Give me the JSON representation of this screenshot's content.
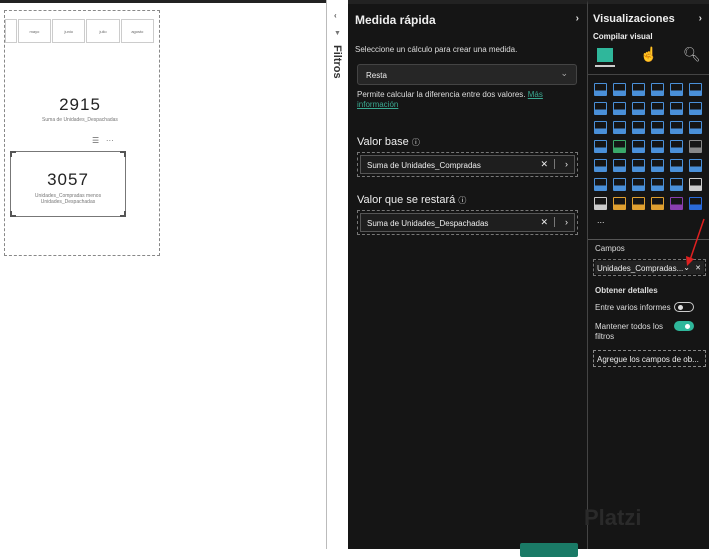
{
  "canvas": {
    "slicer_months": [
      "",
      "mayo",
      "junio",
      "julio",
      "agosto"
    ],
    "card1": {
      "value": "2915",
      "label": "Suma de Unidades_Despachadas"
    },
    "card2": {
      "value": "3057",
      "label": "Unidades_Compradas menos Unidades_Despachadas"
    }
  },
  "filters": {
    "label": "Filtros"
  },
  "quick_measure": {
    "title": "Medida rápida",
    "prompt": "Seleccione un cálculo para crear una medida.",
    "calculation": "Resta",
    "help": "Permite calcular la diferencia entre dos valores.",
    "help_link": "Más información",
    "base_label": "Valor base",
    "base_value": "Suma de Unidades_Compradas",
    "subtract_label": "Valor que se restará",
    "subtract_value": "Suma de Unidades_Despachadas"
  },
  "visualizations": {
    "title": "Visualizaciones",
    "subtitle": "Compilar visual",
    "more": "...",
    "icons": [
      {
        "name": "stacked-bar-icon",
        "color": "#4a90d9"
      },
      {
        "name": "stacked-column-icon",
        "color": "#4a90d9"
      },
      {
        "name": "clustered-bar-icon",
        "color": "#4a90d9"
      },
      {
        "name": "clustered-column-icon",
        "color": "#4a90d9"
      },
      {
        "name": "100-bar-icon",
        "color": "#4a90d9"
      },
      {
        "name": "100-column-icon",
        "color": "#4a90d9"
      },
      {
        "name": "line-chart-icon",
        "color": "#4a90d9"
      },
      {
        "name": "area-chart-icon",
        "color": "#4a90d9"
      },
      {
        "name": "stacked-area-icon",
        "color": "#4a90d9"
      },
      {
        "name": "ribbon-area-icon",
        "color": "#4a90d9"
      },
      {
        "name": "line-column-icon",
        "color": "#4a90d9"
      },
      {
        "name": "line-clustered-icon",
        "color": "#4a90d9"
      },
      {
        "name": "ribbon-chart-icon",
        "color": "#4a90d9"
      },
      {
        "name": "waterfall-icon",
        "color": "#4a90d9"
      },
      {
        "name": "funnel-icon",
        "color": "#4a90d9"
      },
      {
        "name": "scatter-icon",
        "color": "#4a90d9"
      },
      {
        "name": "pie-icon",
        "color": "#4a90d9"
      },
      {
        "name": "donut-icon",
        "color": "#4a90d9"
      },
      {
        "name": "treemap-icon",
        "color": "#4a90d9"
      },
      {
        "name": "map-icon",
        "color": "#3aa96a"
      },
      {
        "name": "filled-map-icon",
        "color": "#4a90d9"
      },
      {
        "name": "azure-map-icon",
        "color": "#4a90d9"
      },
      {
        "name": "gauge-icon",
        "color": "#4a90d9"
      },
      {
        "name": "card-icon",
        "color": "#888888"
      },
      {
        "name": "multirow-card-icon",
        "color": "#4a90d9"
      },
      {
        "name": "kpi-icon",
        "color": "#4a90d9"
      },
      {
        "name": "slicer-icon",
        "color": "#4a90d9"
      },
      {
        "name": "table-icon",
        "color": "#4a90d9"
      },
      {
        "name": "matrix-icon",
        "color": "#4a90d9"
      },
      {
        "name": "r-visual-icon",
        "color": "#4a90d9"
      },
      {
        "name": "python-visual-icon",
        "color": "#4a90d9"
      },
      {
        "name": "key-influencers-icon",
        "color": "#4a90d9"
      },
      {
        "name": "decomposition-tree-icon",
        "color": "#4a90d9"
      },
      {
        "name": "qa-icon",
        "color": "#4a90d9"
      },
      {
        "name": "smart-narrative-icon",
        "color": "#4a90d9"
      },
      {
        "name": "trophy-icon",
        "color": "#cccccc"
      },
      {
        "name": "paginated-report-icon",
        "color": "#cccccc"
      },
      {
        "name": "power-apps-icon",
        "color": "#e0a030"
      },
      {
        "name": "power-automate-icon",
        "color": "#e0a030"
      },
      {
        "name": "arcgis-icon",
        "color": "#e0a030"
      },
      {
        "name": "custom-visual-icon",
        "color": "#8a3fb0"
      },
      {
        "name": "chevrons-visual-icon",
        "color": "#2a6ad9"
      }
    ],
    "fields_label": "Campos",
    "field_value": "Unidades_Compradas...",
    "details_label": "Obtener detalles",
    "cross_report": "Entre varios informes",
    "keep_filters": "Mantener todos los filtros",
    "drop_placeholder": "Agregue los campos de ob..."
  },
  "watermark": "Platzi",
  "colors": {
    "accent": "#2fb79b",
    "panel": "#151515"
  }
}
